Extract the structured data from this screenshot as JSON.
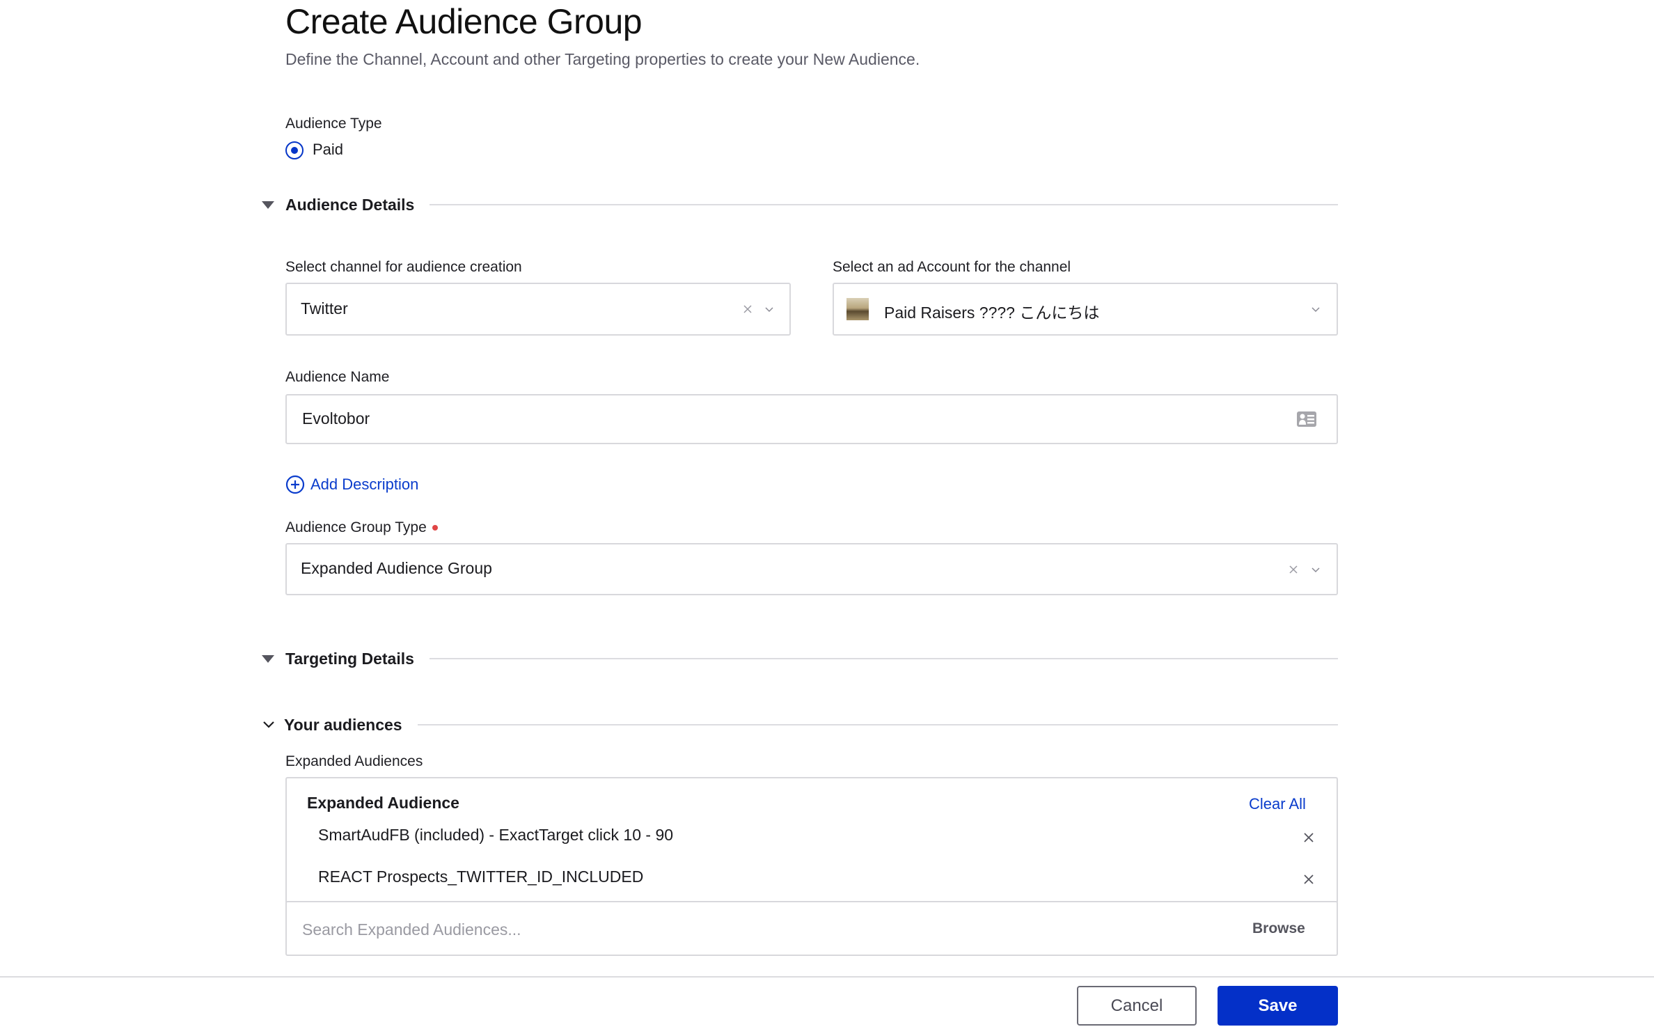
{
  "header": {
    "title": "Create Audience Group",
    "subtitle": "Define the Channel, Account and other Targeting properties to create your New Audience."
  },
  "audience_type": {
    "label": "Audience Type",
    "options": [
      {
        "label": "Paid",
        "selected": true
      }
    ]
  },
  "sections": {
    "audience_details": "Audience Details",
    "targeting_details": "Targeting Details",
    "your_audiences": "Your audiences"
  },
  "channel": {
    "label": "Select channel for audience creation",
    "value": "Twitter"
  },
  "ad_account": {
    "label": "Select an ad Account for the channel",
    "value": "Paid Raisers ???? こんにちは"
  },
  "audience_name": {
    "label": "Audience Name",
    "value": "Evoltobor"
  },
  "add_description": {
    "label": "Add Description"
  },
  "group_type": {
    "label": "Audience Group Type",
    "required": true,
    "value": "Expanded Audience Group"
  },
  "expanded": {
    "label": "Expanded Audiences",
    "box_title": "Expanded Audience",
    "clear_all": "Clear All",
    "items": [
      {
        "label": "SmartAudFB (included) - ExactTarget click 10 - 90"
      },
      {
        "label": "REACT Prospects_TWITTER_ID_INCLUDED"
      }
    ],
    "search_placeholder": "Search Expanded Audiences...",
    "browse": "Browse"
  },
  "footer": {
    "cancel": "Cancel",
    "save": "Save"
  },
  "colors": {
    "accent": "#0430c8",
    "link": "#0a3ccc",
    "required": "#e04545",
    "border": "#d8d8dc"
  }
}
